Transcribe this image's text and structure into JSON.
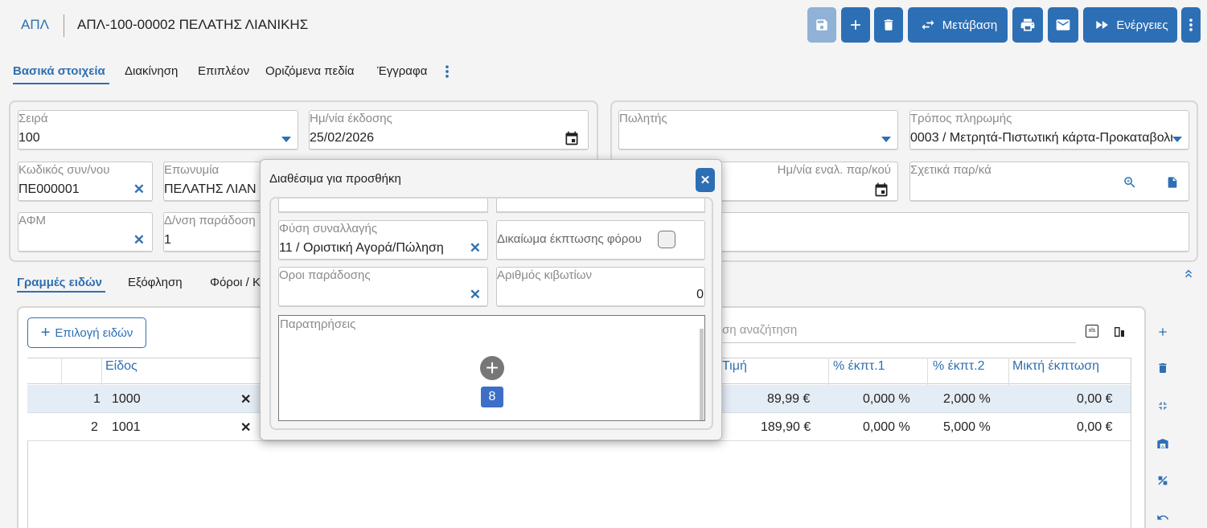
{
  "header": {
    "brand": "ΑΠΛ",
    "title": "ΑΠΛ-100-00002 ΠΕΛΑΤΗΣ ΛΙΑΝΙΚΗΣ",
    "buttons": {
      "save": "save-icon",
      "add": "plus-icon",
      "delete": "trash-icon",
      "transition_label": "Μετάβαση",
      "print": "printer-icon",
      "email": "envelope-icon",
      "actions_label": "Ενέργειες",
      "more": "kebab-icon"
    }
  },
  "tabs": [
    {
      "label": "Βασικά στοιχεία",
      "active": true
    },
    {
      "label": "Διακίνηση"
    },
    {
      "label": "Επιπλέον"
    },
    {
      "label": "Οριζόμενα πεδία"
    },
    {
      "label": "Έγγραφα"
    }
  ],
  "form": {
    "series": {
      "label": "Σειρά",
      "value": "100"
    },
    "issue_date": {
      "label": "Ημ/νία έκδοσης",
      "value": "25/02/2026"
    },
    "customer_code": {
      "label": "Κωδικός συν/νου",
      "value": "ΠΕ000001"
    },
    "name": {
      "label": "Επωνυμία",
      "value": "ΠΕΛΑΤΗΣ ΛΙΑΝ"
    },
    "vat": {
      "label": "ΑΦΜ",
      "value": ""
    },
    "delivery_address": {
      "label": "Δ/νση παράδοση",
      "value": "1"
    },
    "salesperson": {
      "label": "Πωλητής",
      "value": ""
    },
    "payment_method": {
      "label": "Τρόπος πληρωμής",
      "value": "0003 / Μετρητά-Πιστωτική κάρτα-Προκαταβολή"
    },
    "alt_order_date": {
      "label": "Ημ/νία εναλ. παρ/κού",
      "value": ""
    },
    "related_docs": {
      "label": "Σχετικά παρ/κά",
      "value": ""
    }
  },
  "lower_tabs": [
    {
      "label": "Γραμμές ειδών",
      "active": true
    },
    {
      "label": "Εξόφληση"
    },
    {
      "label": "Φόροι / Κ"
    }
  ],
  "grid": {
    "select_items_label": "Επιλογή ειδών",
    "search_placeholder": "ση αναζήτηση",
    "columns": [
      "Είδος",
      "Τιμή",
      "% έκπτ.1",
      "% έκπτ.2",
      "Μικτή έκπτωση"
    ],
    "rows": [
      {
        "num": "1",
        "item": "1000",
        "price": "89,99 €",
        "disc1": "0,000 %",
        "disc2": "2,000 %",
        "gross_disc": "0,00 €"
      },
      {
        "num": "2",
        "item": "1001",
        "price": "189,90 €",
        "disc1": "0,000 %",
        "disc2": "5,000 %",
        "gross_disc": "0,00 €"
      }
    ]
  },
  "modal": {
    "title": "Διαθέσιμα για προσθήκη",
    "transaction_type": {
      "label": "Φύση συναλλαγής",
      "value": "11 / Οριστική Αγορά/Πώληση"
    },
    "vat_deduction": {
      "label": "Δικαίωμα έκπτωσης φόρου"
    },
    "delivery_terms": {
      "label": "Οροι παράδοσης",
      "value": ""
    },
    "boxes_count": {
      "label": "Αριθμός κιβωτίων",
      "value": "0"
    },
    "remarks": {
      "label": "Παρατηρήσεις"
    },
    "badge": "8"
  },
  "colors": {
    "accent": "#2d6fb5",
    "accent_disabled": "#8fb2d6"
  }
}
